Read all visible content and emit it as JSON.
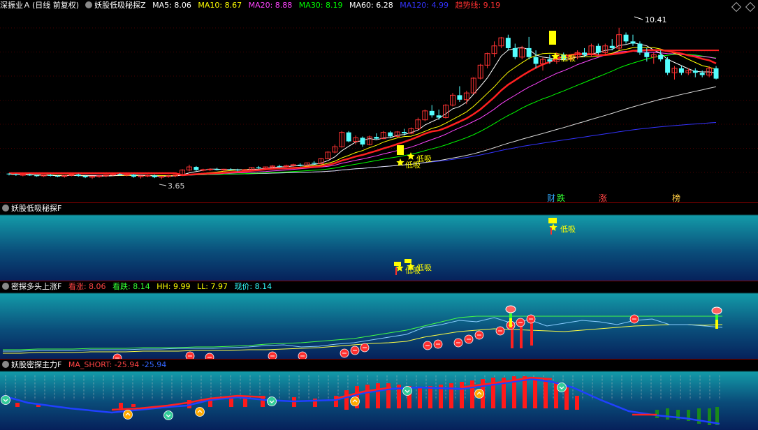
{
  "main": {
    "stock": "深振业Ａ",
    "period": "(日线 前复权)",
    "indicator": "妖股低吸秘探Z",
    "ma5": "MA5: 8.06",
    "ma10": "MA10: 8.67",
    "ma20": "MA20: 8.88",
    "ma30": "MA30: 8.19",
    "ma60": "MA60: 6.28",
    "ma120": "MA120: 4.99",
    "trend": "趋势线: 9.19",
    "high_label": "10.41",
    "low_label": "3.65",
    "signal": "低吸",
    "event_tags": [
      "财",
      "跌",
      "涨",
      "榜"
    ]
  },
  "panel2": {
    "title": "妖股低吸秘探F",
    "signal": "低吸"
  },
  "panel3": {
    "title": "密探多头上涨F",
    "up": "看涨: 8.06",
    "down": "看跌: 8.14",
    "hh": "HH: 9.99",
    "ll": "LL: 7.97",
    "price": "现价: 8.14"
  },
  "panel4": {
    "title": "妖股密探主力F",
    "ma_short": "MA_SHORT: -25.94",
    "ma_value": "-25.94"
  },
  "colors": {
    "up": "#ff3232",
    "down": "#54ffff",
    "ma5": "#ffffff",
    "ma10": "#ffff00",
    "ma20": "#ff44ff",
    "ma30": "#00ff00",
    "ma60": "#ffffff",
    "ma120": "#3333ff",
    "trend": "#ff2020"
  },
  "chart_data": [
    {
      "type": "candlestick",
      "title": "妖股低吸秘探Z",
      "price_high": 10.41,
      "price_low": 3.65,
      "ohlc": [
        [
          3.9,
          3.92,
          3.82,
          3.88
        ],
        [
          3.88,
          3.9,
          3.8,
          3.84
        ],
        [
          3.84,
          3.88,
          3.78,
          3.86
        ],
        [
          3.86,
          3.9,
          3.8,
          3.82
        ],
        [
          3.82,
          3.86,
          3.76,
          3.8
        ],
        [
          3.8,
          3.86,
          3.75,
          3.84
        ],
        [
          3.84,
          3.88,
          3.78,
          3.8
        ],
        [
          3.8,
          3.84,
          3.74,
          3.78
        ],
        [
          3.78,
          3.84,
          3.72,
          3.82
        ],
        [
          3.82,
          3.88,
          3.78,
          3.86
        ],
        [
          3.86,
          3.9,
          3.76,
          3.8
        ],
        [
          3.8,
          3.84,
          3.7,
          3.74
        ],
        [
          3.74,
          3.8,
          3.66,
          3.78
        ],
        [
          3.78,
          3.84,
          3.72,
          3.8
        ],
        [
          3.8,
          3.86,
          3.74,
          3.84
        ],
        [
          3.84,
          3.92,
          3.8,
          3.88
        ],
        [
          3.88,
          3.92,
          3.8,
          3.84
        ],
        [
          3.84,
          3.9,
          3.78,
          3.86
        ],
        [
          3.86,
          3.88,
          3.72,
          3.76
        ],
        [
          3.76,
          3.82,
          3.68,
          3.8
        ],
        [
          3.8,
          3.86,
          3.74,
          3.82
        ],
        [
          3.82,
          3.86,
          3.7,
          3.74
        ],
        [
          3.74,
          3.8,
          3.65,
          3.78
        ],
        [
          3.78,
          3.84,
          3.72,
          3.8
        ],
        [
          3.8,
          3.86,
          3.74,
          3.84
        ],
        [
          3.84,
          4.1,
          3.82,
          4.06
        ],
        [
          4.06,
          4.3,
          4.0,
          4.2
        ],
        [
          4.2,
          4.24,
          4.02,
          4.06
        ],
        [
          4.06,
          4.12,
          4.0,
          4.08
        ],
        [
          4.08,
          4.14,
          4.02,
          4.1
        ],
        [
          4.1,
          4.16,
          4.04,
          4.06
        ],
        [
          4.06,
          4.12,
          4.0,
          4.1
        ],
        [
          4.1,
          4.14,
          4.04,
          4.08
        ],
        [
          4.08,
          4.12,
          4.0,
          4.04
        ],
        [
          4.04,
          4.1,
          4.0,
          4.08
        ],
        [
          4.08,
          4.2,
          4.06,
          4.18
        ],
        [
          4.18,
          4.24,
          4.1,
          4.14
        ],
        [
          4.14,
          4.22,
          4.08,
          4.2
        ],
        [
          4.2,
          4.28,
          4.14,
          4.24
        ],
        [
          4.24,
          4.3,
          4.16,
          4.22
        ],
        [
          4.22,
          4.3,
          4.18,
          4.26
        ],
        [
          4.26,
          4.34,
          4.2,
          4.3
        ],
        [
          4.3,
          4.36,
          4.22,
          4.26
        ],
        [
          4.26,
          4.4,
          4.24,
          4.38
        ],
        [
          4.38,
          4.46,
          4.3,
          4.34
        ],
        [
          4.34,
          4.6,
          4.32,
          4.56
        ],
        [
          4.56,
          4.9,
          4.54,
          4.86
        ],
        [
          4.86,
          5.2,
          4.8,
          5.1
        ],
        [
          5.1,
          5.8,
          5.06,
          5.74
        ],
        [
          5.74,
          5.8,
          5.3,
          5.34
        ],
        [
          5.34,
          5.6,
          5.2,
          5.5
        ],
        [
          5.5,
          5.56,
          5.1,
          5.2
        ],
        [
          5.2,
          5.6,
          5.16,
          5.54
        ],
        [
          5.54,
          5.7,
          5.4,
          5.46
        ],
        [
          5.46,
          5.8,
          5.44,
          5.74
        ],
        [
          5.74,
          5.8,
          5.5,
          5.56
        ],
        [
          5.56,
          5.8,
          5.5,
          5.76
        ],
        [
          5.76,
          5.9,
          5.6,
          5.7
        ],
        [
          5.7,
          5.96,
          5.66,
          5.9
        ],
        [
          5.9,
          6.4,
          5.86,
          6.3
        ],
        [
          6.3,
          6.76,
          6.24,
          6.7
        ],
        [
          6.7,
          6.96,
          6.4,
          6.5
        ],
        [
          6.5,
          6.76,
          6.3,
          6.4
        ],
        [
          6.4,
          7.0,
          6.36,
          6.96
        ],
        [
          6.96,
          7.5,
          6.9,
          7.4
        ],
        [
          7.4,
          7.8,
          7.1,
          7.2
        ],
        [
          7.2,
          7.6,
          7.0,
          7.5
        ],
        [
          7.5,
          8.2,
          7.46,
          8.16
        ],
        [
          8.16,
          8.8,
          8.1,
          8.74
        ],
        [
          8.74,
          9.3,
          8.6,
          9.26
        ],
        [
          9.26,
          9.8,
          9.1,
          9.6
        ],
        [
          9.6,
          10.0,
          9.5,
          9.96
        ],
        [
          9.96,
          10.1,
          9.4,
          9.5
        ],
        [
          9.5,
          9.7,
          9.0,
          9.1
        ],
        [
          9.1,
          9.6,
          9.0,
          9.5
        ],
        [
          9.5,
          10.0,
          9.0,
          9.1
        ],
        [
          9.1,
          9.4,
          8.6,
          8.8
        ],
        [
          8.8,
          9.1,
          8.5,
          9.0
        ],
        [
          9.0,
          9.2,
          8.8,
          8.9
        ],
        [
          8.9,
          9.3,
          8.8,
          9.2
        ],
        [
          9.2,
          9.3,
          8.9,
          9.0
        ],
        [
          9.0,
          9.2,
          8.9,
          9.1
        ],
        [
          9.1,
          9.4,
          9.0,
          9.3
        ],
        [
          9.3,
          9.5,
          9.1,
          9.2
        ],
        [
          9.2,
          9.7,
          9.1,
          9.6
        ],
        [
          9.6,
          9.7,
          9.2,
          9.3
        ],
        [
          9.3,
          9.7,
          9.2,
          9.6
        ],
        [
          9.6,
          9.9,
          9.4,
          9.5
        ],
        [
          9.5,
          10.41,
          9.4,
          10.1
        ],
        [
          10.1,
          10.2,
          9.7,
          9.8
        ],
        [
          9.8,
          10.1,
          9.6,
          9.7
        ],
        [
          9.7,
          9.8,
          9.2,
          9.3
        ],
        [
          9.3,
          9.5,
          8.9,
          9.1
        ],
        [
          9.1,
          9.3,
          8.8,
          9.2
        ],
        [
          9.2,
          9.4,
          8.9,
          9.0
        ],
        [
          9.0,
          9.1,
          8.3,
          8.4
        ],
        [
          8.4,
          8.7,
          8.1,
          8.6
        ],
        [
          8.6,
          8.7,
          8.3,
          8.4
        ],
        [
          8.4,
          8.6,
          8.3,
          8.5
        ],
        [
          8.5,
          8.6,
          8.2,
          8.4
        ],
        [
          8.4,
          8.5,
          8.2,
          8.3
        ],
        [
          8.3,
          8.7,
          8.2,
          8.6
        ],
        [
          8.6,
          8.7,
          8.1,
          8.14
        ]
      ]
    }
  ]
}
